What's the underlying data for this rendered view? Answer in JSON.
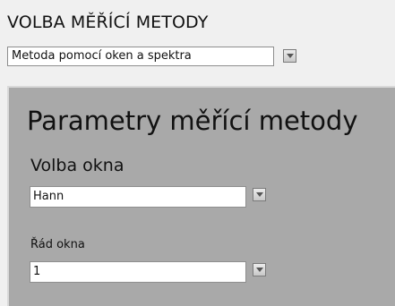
{
  "measurement_method": {
    "title": "VOLBA MĚŘÍCÍ METODY",
    "selected": "Metoda pomocí oken a spektra"
  },
  "parameters": {
    "title": "Parametry měřící metody",
    "window_label": "Volba okna",
    "window_value": "Hann",
    "order_label": "Řád okna",
    "order_value": "1"
  }
}
